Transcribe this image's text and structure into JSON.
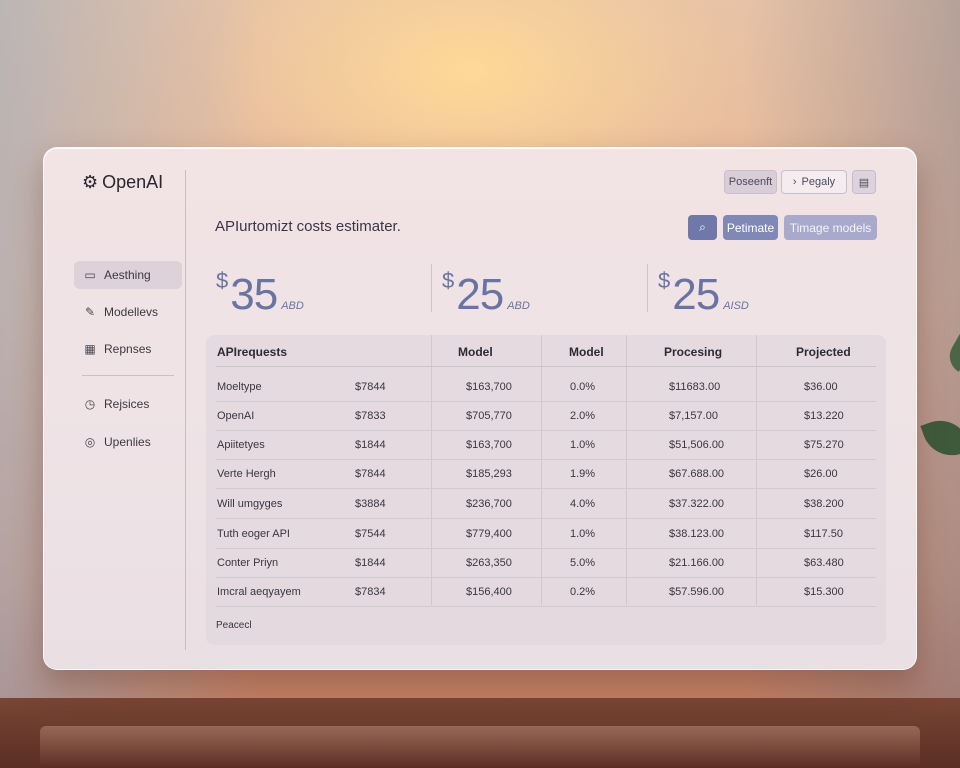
{
  "app": {
    "brand": "OpenAI",
    "logo_icon": "gear-icon"
  },
  "sidebar": {
    "items": [
      {
        "label": "Aesthing",
        "icon": "folder-icon",
        "active": true
      },
      {
        "label": "Modellevs",
        "icon": "pen-icon",
        "active": false
      },
      {
        "label": "Repnses",
        "icon": "calendar-icon",
        "active": false
      },
      {
        "label": "Rejsices",
        "icon": "clock-icon",
        "active": false
      },
      {
        "label": "Upenlies",
        "icon": "globe-icon",
        "active": false
      }
    ]
  },
  "toolbar": {
    "btn1": "Poseenft",
    "btn2": "Pegaly",
    "btn2_icon": "chevron-right-icon",
    "btn3_icon": "document-icon"
  },
  "header": {
    "subtitle": "APIurtomizt costs estimater."
  },
  "actions": {
    "search_icon": "search-icon",
    "estimate": "Petimate",
    "models": "Timage models"
  },
  "metrics": [
    {
      "currency": "$",
      "value": "35",
      "unit": "ABD"
    },
    {
      "currency": "$",
      "value": "25",
      "unit": "ABD"
    },
    {
      "currency": "$",
      "value": "25",
      "unit": "AISD"
    }
  ],
  "table": {
    "headers": [
      "APIrequests",
      "Model",
      "Model",
      "Procesing",
      "Projected"
    ],
    "rows": [
      [
        "Moeltype",
        "$7844",
        "$163,700",
        "0.0%",
        "$11683.00",
        "$36.00"
      ],
      [
        "OpenAI",
        "$7833",
        "$705,770",
        "2.0%",
        "$7,157.00",
        "$13.220"
      ],
      [
        "Apiitetyes",
        "$1844",
        "$163,700",
        "1.0%",
        "$51,506.00",
        "$75.270"
      ],
      [
        "Verte Hergh",
        "$7844",
        "$185,293",
        "1.9%",
        "$67.688.00",
        "$26.00"
      ],
      [
        "Will umgyges",
        "$3884",
        "$236,700",
        "4.0%",
        "$37.322.00",
        "$38.200"
      ],
      [
        "Tuth eoger API",
        "$7544",
        "$779,400",
        "1.0%",
        "$38.123.00",
        "$117.50"
      ],
      [
        "Conter Priyn",
        "$1844",
        "$263,350",
        "5.0%",
        "$21.166.00",
        "$63.480"
      ],
      [
        "Imcral aeqyayem",
        "$7834",
        "$156,400",
        "0.2%",
        "$57.596.00",
        "$15.300"
      ]
    ],
    "footer": "Peacecl"
  },
  "colors": {
    "accent": "#6f78a8",
    "metric": "#6a74a2"
  }
}
